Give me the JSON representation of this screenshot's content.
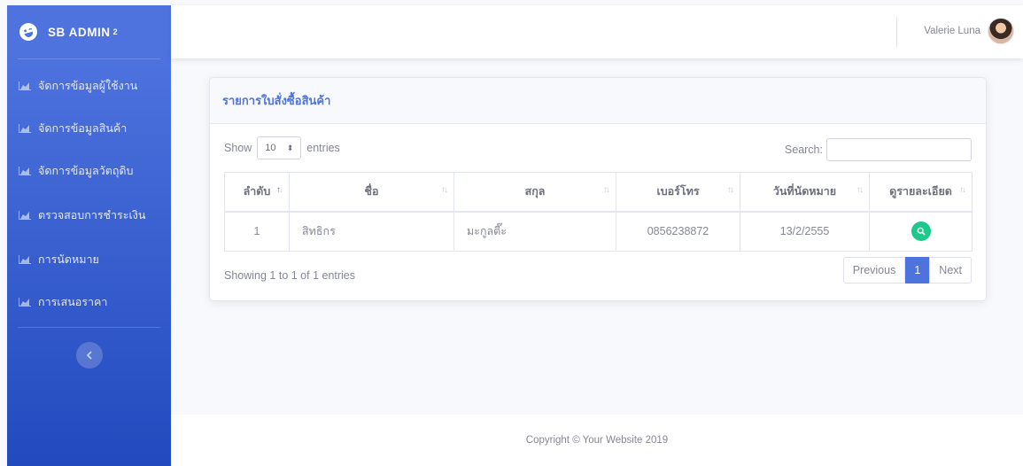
{
  "brand": {
    "name": "SB ADMIN",
    "sup": "2"
  },
  "sidebar": {
    "items": [
      {
        "label": "จัดการข้อมูลผู้ใช้งาน",
        "icon": "chart-area-icon"
      },
      {
        "label": "จัดการข้อมูลสินค้า",
        "icon": "chart-area-icon"
      },
      {
        "label": "จัดการข้อมูลวัตถุดิบ",
        "icon": "chart-area-icon"
      },
      {
        "label": "ตรวจสอบการชำระเงิน",
        "icon": "chart-area-icon"
      },
      {
        "label": "การนัดหมาย",
        "icon": "chart-area-icon"
      },
      {
        "label": "การเสนอราคา",
        "icon": "chart-area-icon"
      }
    ],
    "toggle_icon": "chevron-left-icon"
  },
  "topbar": {
    "user_name": "Valerie Luna"
  },
  "card": {
    "title": "รายการใบสั่งซื้อสินค้า"
  },
  "table_controls": {
    "show_label": "Show",
    "entries_value": "10",
    "entries_label": "entries",
    "search_label": "Search:",
    "search_value": ""
  },
  "table": {
    "columns": [
      "ลำดับ",
      "ชื่อ",
      "สกุล",
      "เบอร์โทร",
      "วันที่นัดหมาย",
      "ดูรายละเอียด"
    ],
    "rows": [
      {
        "index": "1",
        "first_name": "สิทธิกร",
        "last_name": "มะกูลตี๊ะ",
        "phone": "0856238872",
        "date": "13/2/2555"
      }
    ]
  },
  "info": "Showing 1 to 1 of 1 entries",
  "pagination": {
    "previous": "Previous",
    "current": "1",
    "next": "Next"
  },
  "footer": {
    "copyright": "Copyright © Your Website 2019"
  },
  "colors": {
    "primary": "#4e73df",
    "success": "#1cc88a",
    "text": "#858796"
  }
}
